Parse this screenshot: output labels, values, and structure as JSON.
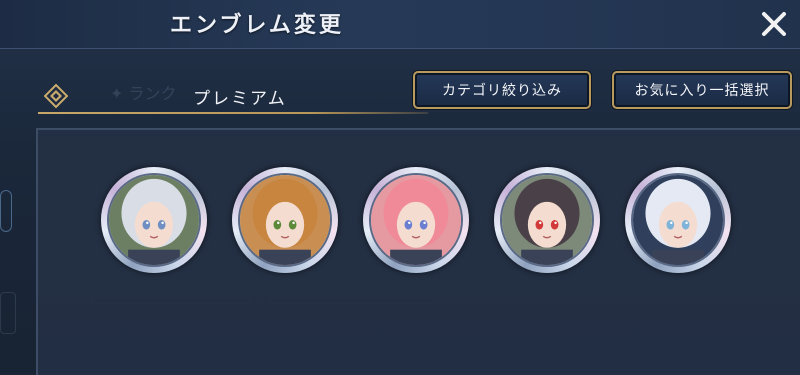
{
  "header": {
    "title": "エンブレム変更"
  },
  "tab": {
    "label": "プレミアム"
  },
  "buttons": {
    "filter_label": "カテゴリ絞り込み",
    "bulk_select_label": "お気に入り一括選択"
  },
  "emblems": [
    {
      "name": "silver-haired-knight",
      "bg": "#6d7f63",
      "hair": "#d9dde6",
      "eyes": "#6f8fc2"
    },
    {
      "name": "orange-haired-girl",
      "bg": "#c98f52",
      "hair": "#c7853f",
      "eyes": "#5d8a3a"
    },
    {
      "name": "pink-haired-girl",
      "bg": "#e59aa2",
      "hair": "#f08a98",
      "eyes": "#6a7fd0"
    },
    {
      "name": "dark-haired-girl",
      "bg": "#7e8a79",
      "hair": "#4a4148",
      "eyes": "#d23a3a"
    },
    {
      "name": "white-haired-girl",
      "bg": "#2f3f5c",
      "hair": "#e4e9f3",
      "eyes": "#7fb3d9"
    }
  ]
}
